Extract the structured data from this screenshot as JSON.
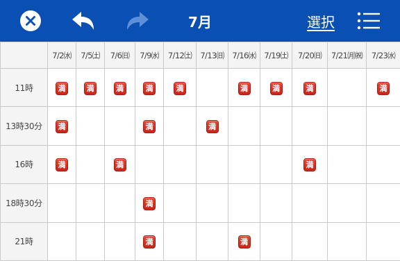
{
  "header": {
    "month_title": "7月",
    "select_label": "選択",
    "close_icon": "close-circle-icon",
    "undo_icon": "undo-arrow-icon",
    "redo_icon": "redo-arrow-icon",
    "menu_icon": "list-menu-icon",
    "redo_enabled": false
  },
  "colors": {
    "header_bg": "#0a4fb3",
    "full_badge": "#d9321f",
    "redo_disabled": "#5f8fd6"
  },
  "schedule": {
    "full_label": "満",
    "dates": [
      "7/2㈬",
      "7/5㈯",
      "7/6㈰",
      "7/9㈬",
      "7/12㈯",
      "7/13㈰",
      "7/16㈬",
      "7/19㈯",
      "7/20㈰",
      "7/21㈪㈷",
      "7/23㈬"
    ],
    "rows": [
      {
        "time": "11時",
        "full": [
          1,
          1,
          1,
          1,
          1,
          0,
          1,
          1,
          1,
          0,
          1
        ]
      },
      {
        "time": "13時30分",
        "full": [
          1,
          0,
          0,
          1,
          0,
          1,
          0,
          0,
          0,
          0,
          0
        ]
      },
      {
        "time": "16時",
        "full": [
          1,
          0,
          1,
          0,
          0,
          0,
          0,
          0,
          1,
          0,
          0
        ]
      },
      {
        "time": "18時30分",
        "full": [
          0,
          0,
          0,
          1,
          0,
          0,
          0,
          0,
          0,
          0,
          0
        ]
      },
      {
        "time": "21時",
        "full": [
          0,
          0,
          0,
          1,
          0,
          0,
          1,
          0,
          0,
          0,
          0
        ]
      }
    ]
  }
}
